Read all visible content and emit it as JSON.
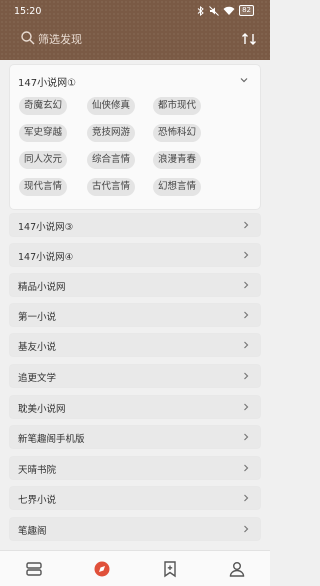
{
  "status_bar": {
    "time": "15:20",
    "battery": "82",
    "icons": [
      "gallery-icon",
      "bluetooth-icon",
      "mute-icon",
      "wifi-icon",
      "battery-icon"
    ]
  },
  "search": {
    "placeholder": "筛选发现"
  },
  "expanded_group": {
    "title": "147小说网①",
    "tags": [
      "奇魔玄幻",
      "仙侠修真",
      "都市现代",
      "军史穿越",
      "竞技网游",
      "恐怖科幻",
      "同人次元",
      "综合言情",
      "浪漫青春",
      "现代言情",
      "古代言情",
      "幻想言情"
    ]
  },
  "collapsed_groups": [
    "147小说网③",
    "147小说网④",
    "精品小说网",
    "第一小说",
    "基友小说",
    "追更文学",
    "耽美小说网",
    "新笔趣阁手机版",
    "天晴书院",
    "七界小说",
    "笔趣阁"
  ],
  "colors": {
    "header": "#7a5a45",
    "background": "#f0f0f0",
    "active_tab": "#e0503a"
  },
  "bottom_nav": [
    {
      "name": "bookshelf",
      "icon": "layers-icon",
      "active": false
    },
    {
      "name": "discover",
      "icon": "compass-icon",
      "active": true
    },
    {
      "name": "bookmarks",
      "icon": "bookmark-add-icon",
      "active": false
    },
    {
      "name": "profile",
      "icon": "person-icon",
      "active": false
    }
  ]
}
